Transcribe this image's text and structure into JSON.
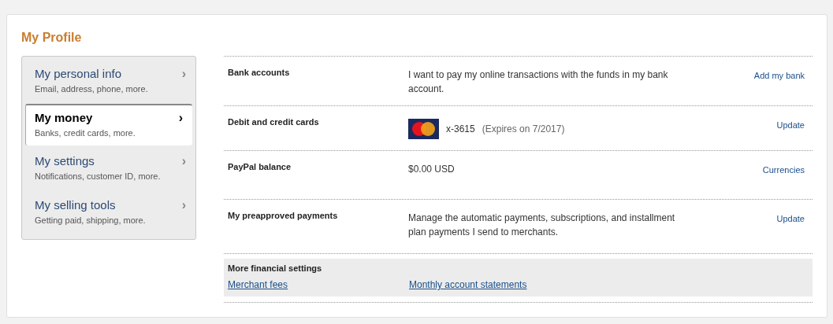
{
  "title": "My Profile",
  "sidebar": {
    "items": [
      {
        "label": "My personal info",
        "description": "Email, address, phone, more.",
        "chevron": "›",
        "selected": false
      },
      {
        "label": "My money",
        "description": "Banks, credit cards, more.",
        "chevron": "›",
        "selected": true
      },
      {
        "label": "My settings",
        "description": "Notifications, customer ID, more.",
        "chevron": "›",
        "selected": false
      },
      {
        "label": "My selling tools",
        "description": "Getting paid, shipping, more.",
        "chevron": "›",
        "selected": false
      }
    ]
  },
  "sections": [
    {
      "kind": "text",
      "label": "Bank accounts",
      "text": "I want to pay my online transactions with the funds in my bank account.",
      "action": "Add my bank"
    },
    {
      "kind": "card",
      "label": "Debit and credit cards",
      "card_number": "x-3615",
      "expiry": "(Expires on 7/2017)",
      "action": "Update"
    },
    {
      "kind": "text",
      "label": "PayPal balance",
      "text": "$0.00 USD",
      "action": "Currencies"
    },
    {
      "kind": "text",
      "label": "My preapproved payments",
      "text": "Manage the automatic payments, subscriptions, and installment plan payments I send to merchants.",
      "action": "Update"
    }
  ],
  "more_settings": {
    "title": "More financial settings",
    "links": [
      "Merchant fees",
      "Monthly account statements"
    ]
  }
}
